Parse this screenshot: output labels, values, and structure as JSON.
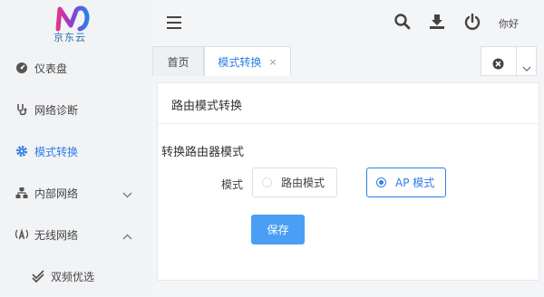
{
  "brand": {
    "name": "京东云"
  },
  "sidebar": {
    "items": [
      {
        "label": "仪表盘",
        "icon": "gauge-icon"
      },
      {
        "label": "网络诊断",
        "icon": "stethoscope-icon"
      },
      {
        "label": "模式转换",
        "icon": "gear-icon",
        "active": true
      },
      {
        "label": "内部网络",
        "icon": "network-icon",
        "expanded": false
      },
      {
        "label": "无线网络",
        "icon": "wireless-icon",
        "expanded": true
      },
      {
        "label": "双频优选",
        "icon": "double-check-icon"
      }
    ]
  },
  "header": {
    "user": "你好"
  },
  "tabs": [
    {
      "label": "首页"
    },
    {
      "label": "模式转换",
      "close": "×"
    }
  ],
  "panel": {
    "title": "路由模式转换",
    "section_title": "转换路由器模式",
    "mode_label": "模式",
    "options": [
      {
        "label": "路由模式",
        "selected": false
      },
      {
        "label": "AP 模式",
        "selected": true
      }
    ],
    "save_label": "保存"
  },
  "colors": {
    "accent": "#2f7ee6",
    "button": "#4a9ff5"
  }
}
